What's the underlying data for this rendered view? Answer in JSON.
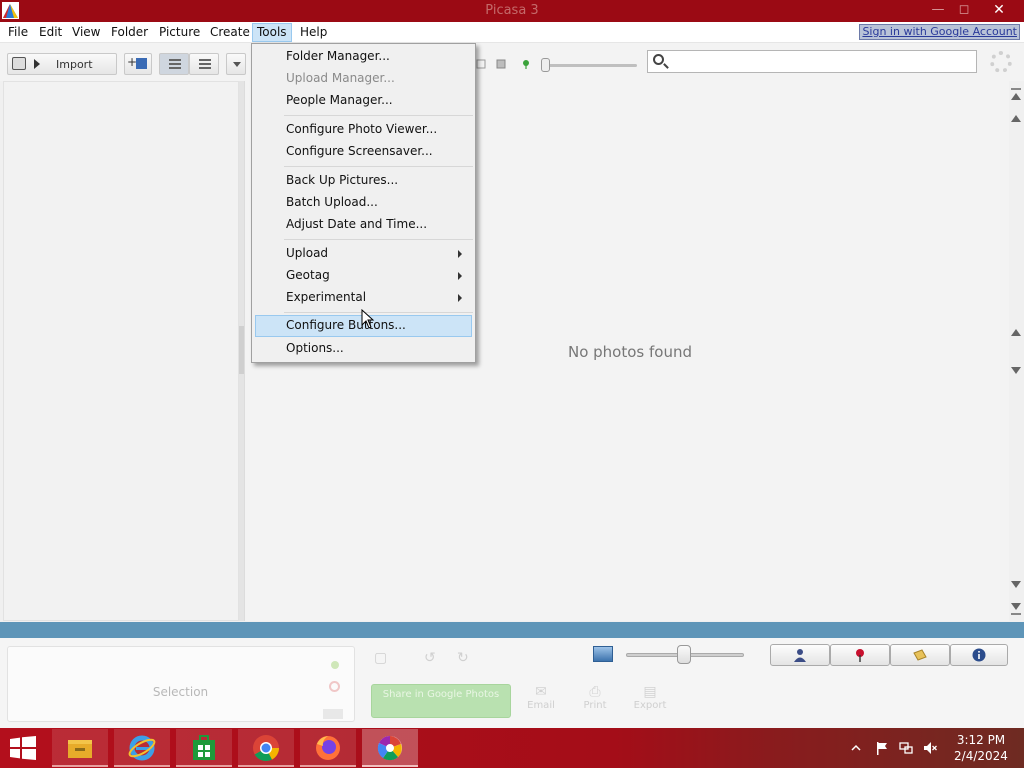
{
  "window": {
    "title": "Picasa 3"
  },
  "menubar": {
    "items": [
      "File",
      "Edit",
      "View",
      "Folder",
      "Picture",
      "Create",
      "Tools",
      "Help"
    ],
    "active": "Tools",
    "sign_in": "Sign in with Google Account"
  },
  "toolbar": {
    "import_label": "Import",
    "search_value": "",
    "search_placeholder": ""
  },
  "main": {
    "empty_message": "No photos found"
  },
  "tools_menu": {
    "items": [
      {
        "label": "Folder Manager...",
        "disabled": false
      },
      {
        "label": "Upload Manager...",
        "disabled": true
      },
      {
        "label": "People Manager...",
        "disabled": false
      },
      {
        "label": "Configure Photo Viewer...",
        "disabled": false
      },
      {
        "label": "Configure Screensaver...",
        "disabled": false
      },
      {
        "label": "Back Up Pictures...",
        "disabled": false
      },
      {
        "label": "Batch Upload...",
        "disabled": false
      },
      {
        "label": "Adjust Date and Time...",
        "disabled": false
      },
      {
        "label": "Upload",
        "submenu": true
      },
      {
        "label": "Geotag",
        "submenu": true
      },
      {
        "label": "Experimental",
        "submenu": true
      },
      {
        "label": "Configure Buttons...",
        "highlighted": true
      },
      {
        "label": "Options...",
        "disabled": false
      }
    ]
  },
  "bottom": {
    "selection_label": "Selection",
    "share_label": "Share in Google Photos",
    "actions": [
      "Email",
      "Print",
      "Export"
    ]
  },
  "taskbar": {
    "apps": [
      "start-icon",
      "file-explorer-icon",
      "internet-explorer-icon",
      "store-icon",
      "chrome-icon",
      "firefox-icon",
      "picasa-icon"
    ],
    "time": "3:12 PM",
    "date": "2/4/2024"
  },
  "colors": {
    "titlebar": "#9b0a14",
    "accent_blue": "#5e95b8",
    "menu_highlight": "#cce4f7",
    "taskbar": "#b30f1c"
  }
}
